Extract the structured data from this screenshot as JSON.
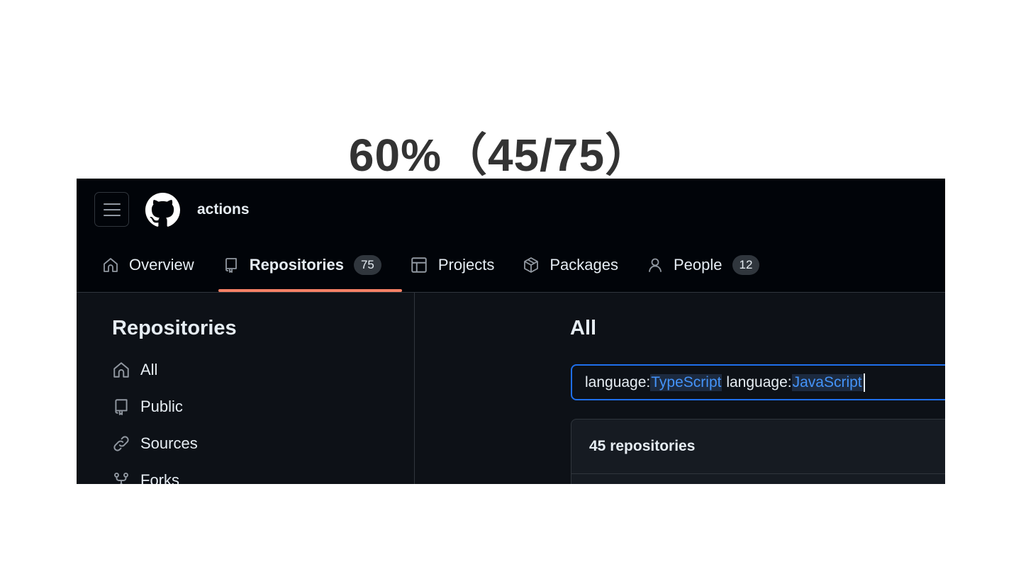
{
  "caption": "60%（45/75）",
  "header": {
    "org_name": "actions",
    "menu_icon": "hamburger-icon",
    "logo_icon": "github-logo-icon"
  },
  "tabs": [
    {
      "label": "Overview",
      "icon": "home-icon"
    },
    {
      "label": "Repositories",
      "icon": "repo-icon",
      "count": "75",
      "active": true
    },
    {
      "label": "Projects",
      "icon": "table-icon"
    },
    {
      "label": "Packages",
      "icon": "package-icon"
    },
    {
      "label": "People",
      "icon": "person-icon",
      "count": "12"
    }
  ],
  "sidebar": {
    "title": "Repositories",
    "items": [
      {
        "label": "All",
        "icon": "home-icon"
      },
      {
        "label": "Public",
        "icon": "repo-icon"
      },
      {
        "label": "Sources",
        "icon": "link-icon"
      },
      {
        "label": "Forks",
        "icon": "fork-icon"
      }
    ]
  },
  "main": {
    "title": "All",
    "search": {
      "key1": "language:",
      "value1": "TypeScript",
      "key2": "language:",
      "value2": "JavaScript"
    },
    "results_count": "45 repositories"
  },
  "colors": {
    "accent": "#1f6feb",
    "tab_underline": "#f78166",
    "background": "#0d1117"
  }
}
